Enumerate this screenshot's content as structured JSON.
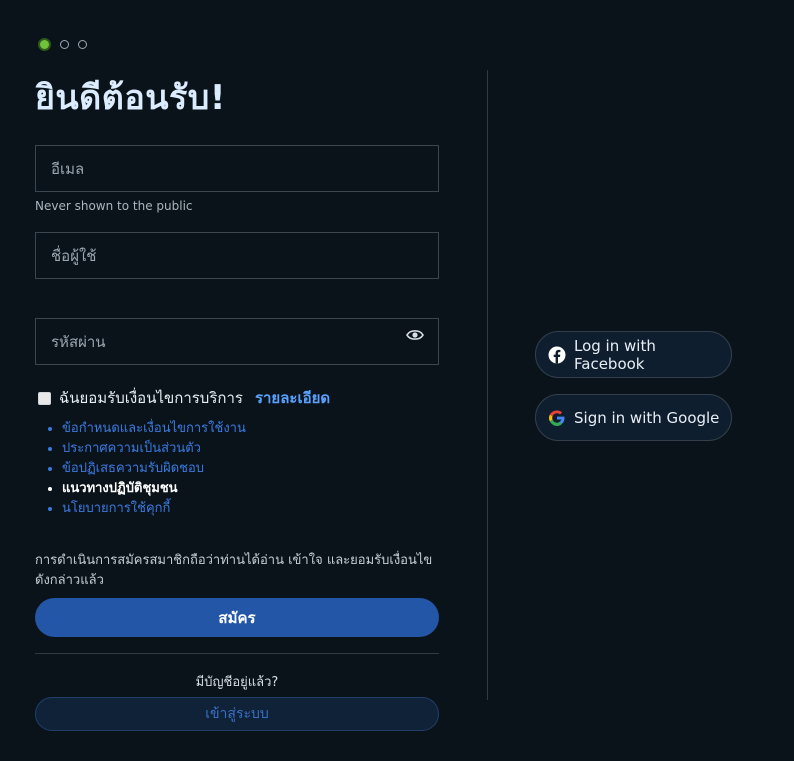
{
  "colors": {
    "background": "#0a131a",
    "accent": "#2456a8",
    "link": "#3a7ae0",
    "step_active": "#6fc23a"
  },
  "steps": [
    "active",
    "inactive",
    "inactive"
  ],
  "heading": "ยินดีต้อนรับ!",
  "form": {
    "email_placeholder": "อีเมล",
    "email_hint": "Never shown to the public",
    "username_placeholder": "ชื่อผู้ใช้",
    "password_placeholder": "รหัสผ่าน",
    "password_toggle_icon": "eye-icon"
  },
  "agreement": {
    "checkbox_label": "ฉันยอมรับเงื่อนไขการบริการ",
    "details_link": "รายละเอียด",
    "checked": false
  },
  "terms_links": [
    "ข้อกำหนดและเงื่อนไขการใช้งาน",
    "ประกาศความเป็นส่วนตัว",
    "ข้อปฏิเสธความรับผิดชอบ",
    "แนวทางปฏิบัติชุมชน",
    "นโยบายการใช้คุกกี้"
  ],
  "consent_text": "การดำเนินการสมัครสมาชิกถือว่าท่านได้อ่าน เข้าใจ และยอมรับเงื่อนไขดังกล่าวแล้ว",
  "submit_label": "สมัคร",
  "have_account": "มีบัญชีอยู่แล้ว?",
  "login_label": "เข้าสู่ระบบ",
  "social": {
    "facebook_label": "Log in with Facebook",
    "facebook_icon": "facebook-icon",
    "google_label": "Sign in with Google",
    "google_icon": "google-icon"
  }
}
